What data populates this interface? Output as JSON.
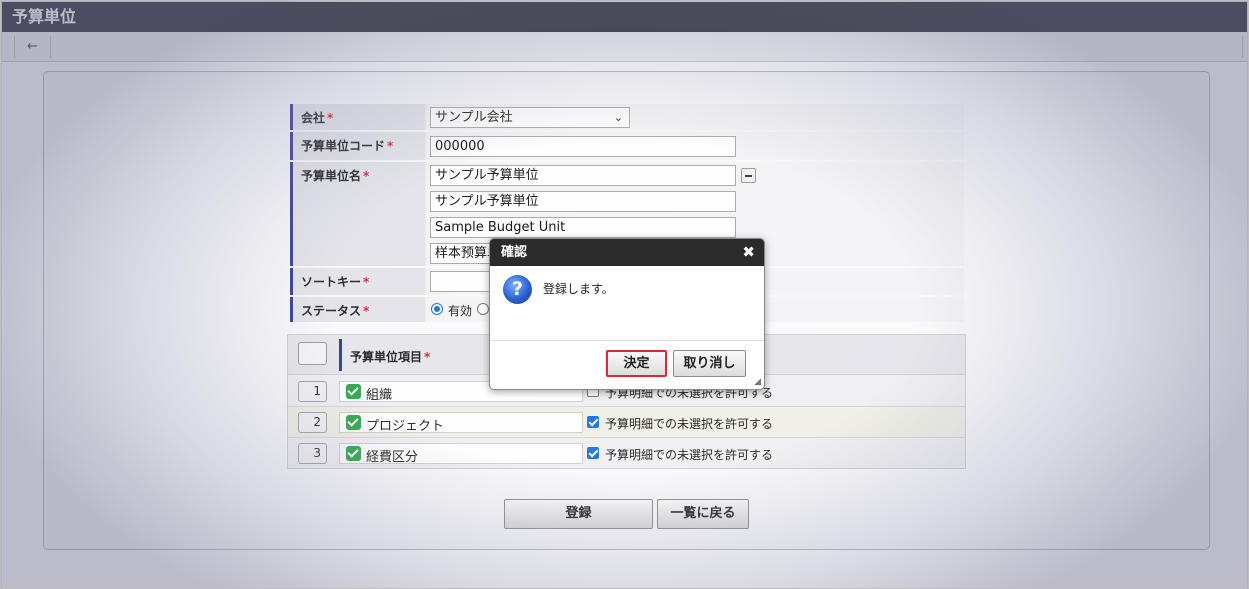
{
  "window": {
    "title": "予算単位"
  },
  "toolbar": {
    "back_icon": "←"
  },
  "form": {
    "company": {
      "label": "会社",
      "required": "*",
      "value": "サンプル会社",
      "chevron": "⌄"
    },
    "code": {
      "label": "予算単位コード",
      "required": "*",
      "value": "000000"
    },
    "name": {
      "label": "予算単位名",
      "required": "*",
      "values": [
        "サンプル予算単位",
        "サンプル予算単位",
        "Sample Budget Unit",
        "样本预算单"
      ]
    },
    "sort_key": {
      "label": "ソートキー",
      "required": "*",
      "value": ""
    },
    "status": {
      "label": "ステータス",
      "required": "*",
      "option_active": "有効",
      "selected": "有効"
    }
  },
  "items": {
    "header": {
      "label": "予算単位項目",
      "required": "*"
    },
    "rows": [
      {
        "num": "1",
        "name": "組織",
        "checked": true,
        "allow_label": "予算明細での未選択を許可する",
        "allow_checked": false
      },
      {
        "num": "2",
        "name": "プロジェクト",
        "checked": true,
        "allow_label": "予算明細での未選択を許可する",
        "allow_checked": true
      },
      {
        "num": "3",
        "name": "経費区分",
        "checked": true,
        "allow_label": "予算明細での未選択を許可する",
        "allow_checked": true
      }
    ]
  },
  "actions": {
    "register": "登録",
    "back_to_list": "一覧に戻る"
  },
  "dialog": {
    "title": "確認",
    "close_icon": "✖",
    "question_icon": "?",
    "message": "登録します。",
    "ok": "決定",
    "cancel": "取り消し",
    "resize_grip": "◢"
  },
  "colors": {
    "titlebar": "#21212b",
    "label_accent": "#2d3d8e",
    "required": "#e0202a",
    "check_green": "#2aa747",
    "highlight": "#e0262e"
  }
}
